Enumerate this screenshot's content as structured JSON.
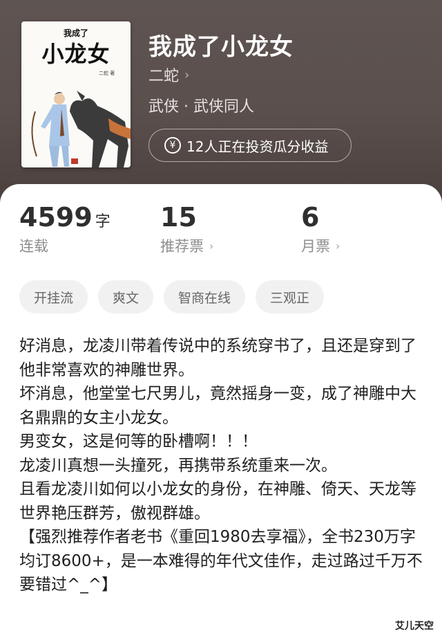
{
  "book": {
    "title": "我成了小龙女",
    "author": "二蛇",
    "genre": "武侠 · 武侠同人",
    "invest_text": "12人正在投资瓜分收益",
    "cover": {
      "small_title": "我成了",
      "big_title": "小龙女",
      "author_mark": "二蛇 著"
    }
  },
  "stats": [
    {
      "value": "4599",
      "unit": "字",
      "label": "连载"
    },
    {
      "value": "15",
      "label": "推荐票"
    },
    {
      "value": "6",
      "label": "月票"
    }
  ],
  "tags": [
    "开挂流",
    "爽文",
    "智商在线",
    "三观正"
  ],
  "description": [
    "好消息，龙凌川带着传说中的系统穿书了，且还是穿到了他非常喜欢的神雕世界。",
    "坏消息，他堂堂七尺男儿，竟然摇身一变，成了神雕中大名鼎鼎的女主小龙女。",
    "男变女，这是何等的卧槽啊！！！",
    "龙凌川真想一头撞死，再携带系统重来一次。",
    "且看龙凌川如何以小龙女的身份，在神雕、倚天、天龙等世界艳压群芳，傲视群雄。",
    "【强烈推荐作者老书《重回1980去享福》，全书230万字均订8600+，是一本难得的年代文佳作，走过路过千万不要错过^_^】"
  ],
  "watermark": "艾儿天空",
  "colors": {
    "hero": "#5a4f4c",
    "tag_bg": "#f1f1f1",
    "text": "#1f1f1f",
    "muted": "#8e8e8e"
  }
}
